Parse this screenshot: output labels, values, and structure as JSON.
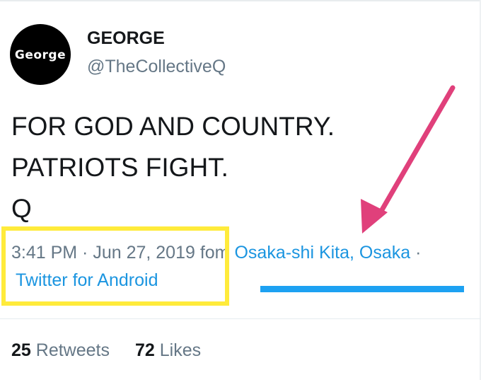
{
  "user": {
    "avatar_text": "George",
    "display_name": "GEORGE",
    "handle": "@TheCollectiveQ"
  },
  "tweet": {
    "lines": [
      "FOR GOD AND COUNTRY.",
      "PATRIOTS FIGHT.",
      "Q"
    ]
  },
  "meta": {
    "time_date": "3:41 PM · Jun 27, 2019 f",
    "from": "om",
    "location": "Osaka-shi Kita, Osaka",
    "separator": "·",
    "source": "Twitter for Android"
  },
  "stats": {
    "retweets_count": "25",
    "retweets_label": "Retweets",
    "likes_count": "72",
    "likes_label": "Likes"
  },
  "annotations": {
    "highlight_color": "#ffeb3b",
    "underline_color": "#1da1f2",
    "arrow_color": "#e0407b",
    "link_color": "#1b95e0"
  }
}
